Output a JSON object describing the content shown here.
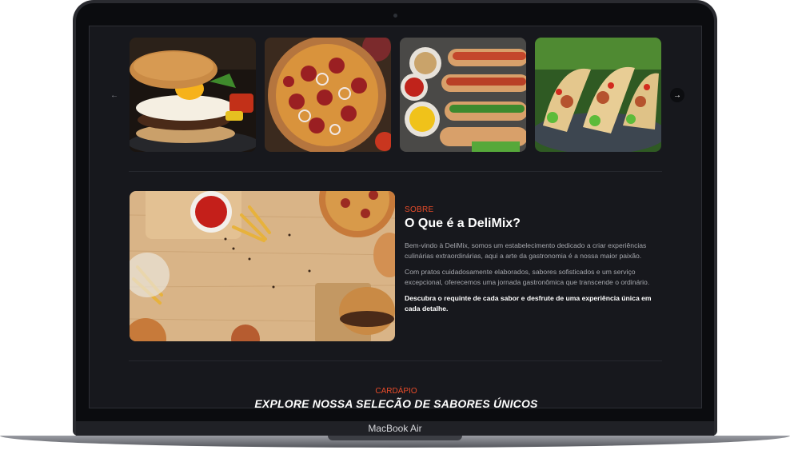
{
  "device": {
    "label": "MacBook Air"
  },
  "carousel": {
    "prev_icon": "arrow-left-icon",
    "next_icon": "arrow-right-icon",
    "prev_glyph": "←",
    "next_glyph": "→",
    "items": [
      {
        "name": "burger",
        "image": "burger-with-egg-photo"
      },
      {
        "name": "pizza",
        "image": "pepperoni-pizza-photo"
      },
      {
        "name": "hotdogs",
        "image": "hot-dogs-with-sauces-photo"
      },
      {
        "name": "tacos",
        "image": "tacos-photo"
      }
    ]
  },
  "about": {
    "eyebrow": "SOBRE",
    "title": "O Que é a DeliMix?",
    "paragraph_1": "Bem-vindo à DeliMix, somos um estabelecimento dedicado a criar experiências culinárias extraordinárias, aqui a arte da gastronomia é a nossa maior paixão.",
    "paragraph_2": "Com pratos cuidadosamente elaborados, sabores sofisticados e um serviço excepcional, oferecemos uma jornada gastronômica que transcende o ordinário.",
    "paragraph_3": "Descubra o requinte de cada sabor e desfrute de uma experiência única em cada detalhe.",
    "image": "fast-food-on-wooden-table-photo"
  },
  "menu": {
    "eyebrow": "CARDÁPIO",
    "title": "EXPLORE NOSSA SELEÇÃO DE SABORES ÚNICOS"
  },
  "colors": {
    "accent": "#e84c2a",
    "background": "#17181d",
    "text": "#ffffff",
    "muted": "#a5a7ad"
  }
}
